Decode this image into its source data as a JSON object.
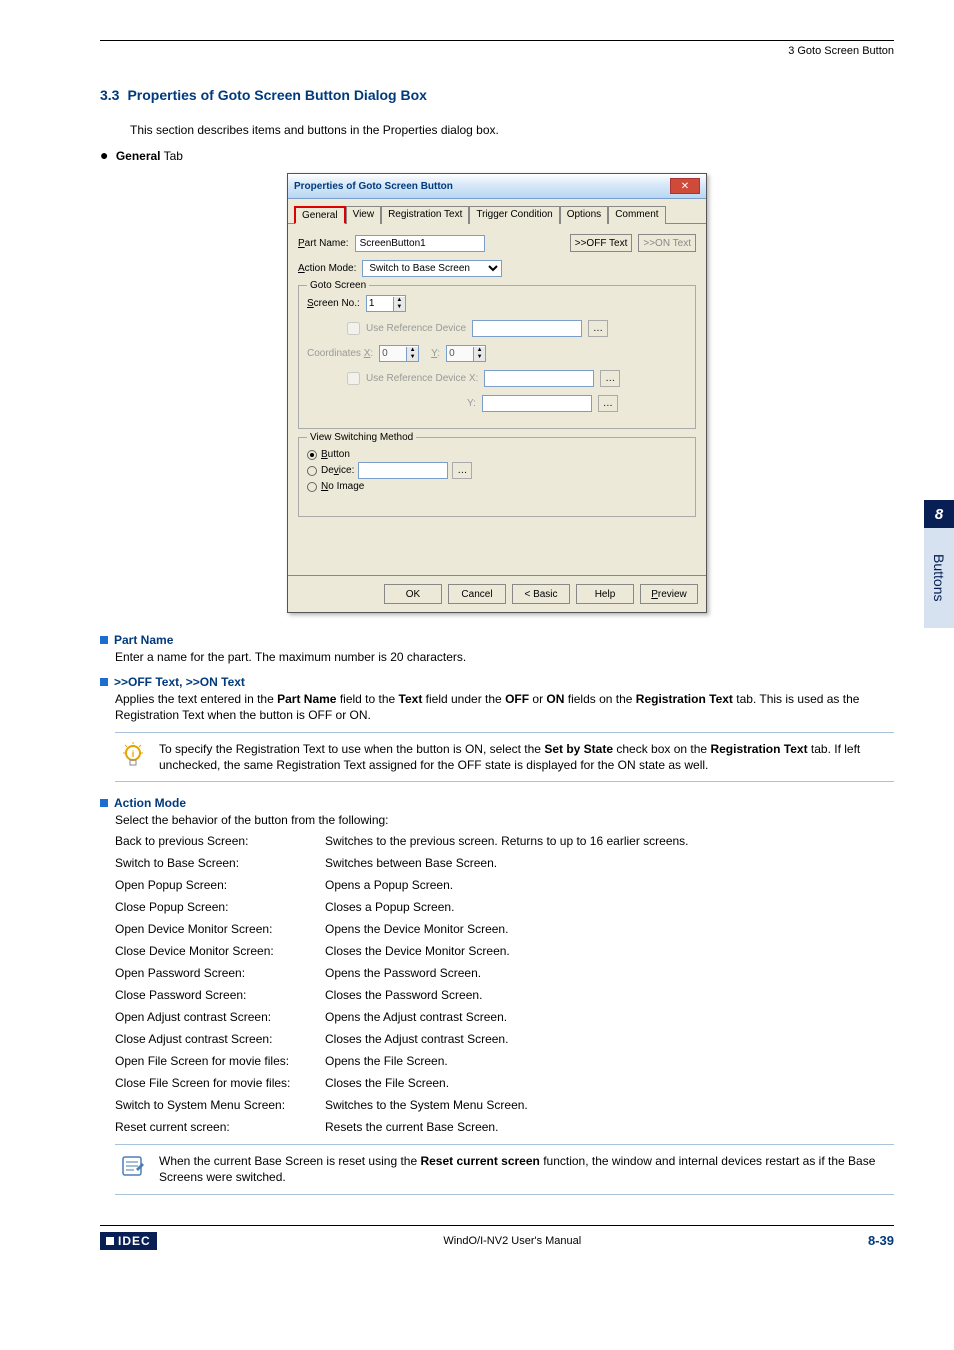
{
  "chapter_ref": "3 Goto Screen Button",
  "section": {
    "num": "3.3",
    "title": "Properties of Goto Screen Button Dialog Box"
  },
  "intro": "This section describes items and buttons in the Properties dialog box.",
  "general_tab_label": "General",
  "tab_suffix": " Tab",
  "dialog": {
    "title": "Properties of Goto Screen Button",
    "tabs": [
      "General",
      "View",
      "Registration Text",
      "Trigger Condition",
      "Options",
      "Comment"
    ],
    "part_name_label": "Part Name:",
    "part_name_value": "ScreenButton1",
    "btn_off_text": ">>OFF Text",
    "btn_on_text": ">>ON Text",
    "action_mode_label": "Action Mode:",
    "action_mode_value": "Switch to Base Screen",
    "group_goto": "Goto Screen",
    "screen_no_label": "Screen No.:",
    "screen_no_value": "1",
    "use_ref_device": "Use Reference Device",
    "coord_label": "Coordinates X:",
    "coord_x": "0",
    "coord_y_label": "Y:",
    "coord_y": "0",
    "use_ref_device_x": "Use Reference Device   X:",
    "coord_y2_label": "Y:",
    "group_view": "View Switching Method",
    "radio_button": "Button",
    "radio_device": "Device:",
    "radio_noimage": "No Image",
    "footer": {
      "ok": "OK",
      "cancel": "Cancel",
      "basic": "< Basic",
      "help": "Help",
      "preview": "Preview"
    }
  },
  "part_name": {
    "heading": "Part Name",
    "body": "Enter a name for the part. The maximum number is 20 characters."
  },
  "off_on": {
    "heading": ">>OFF Text, >>ON Text",
    "body_prefix": "Applies the text entered in the ",
    "bold1": "Part Name",
    "body_mid1": " field to the ",
    "bold2": "Text",
    "body_mid2": " field under the ",
    "bold3": "OFF",
    "body_mid3": " or ",
    "bold4": "ON",
    "body_mid4": " fields on the ",
    "bold5": "Registration Text",
    "body_suffix": " tab. This is used as the Registration Text when the button is OFF or ON."
  },
  "note1": {
    "p1a": "To specify the Registration Text to use when the button is ON, select the ",
    "b1": "Set by State",
    "p1b": " check box on the ",
    "b2": "Registration Text",
    "p1c": " tab. If left unchecked, the same Registration Text assigned for the OFF state is displayed for the ON state as well."
  },
  "action_mode": {
    "heading": "Action Mode",
    "body": "Select the behavior of the button from the following:",
    "rows": [
      {
        "label": "Back to previous Screen:",
        "desc": "Switches to the previous screen. Returns to up to 16 earlier screens."
      },
      {
        "label": "Switch to Base Screen:",
        "desc": "Switches between Base Screen."
      },
      {
        "label": "Open Popup Screen:",
        "desc": "Opens a Popup Screen."
      },
      {
        "label": "Close Popup Screen:",
        "desc": "Closes a Popup Screen."
      },
      {
        "label": "Open Device Monitor Screen:",
        "desc": "Opens the Device Monitor Screen."
      },
      {
        "label": "Close Device Monitor Screen:",
        "desc": "Closes the Device Monitor Screen."
      },
      {
        "label": "Open Password Screen:",
        "desc": "Opens the Password Screen."
      },
      {
        "label": "Close Password Screen:",
        "desc": "Closes the Password Screen."
      },
      {
        "label": "Open Adjust contrast Screen:",
        "desc": "Opens the Adjust contrast Screen."
      },
      {
        "label": "Close Adjust contrast Screen:",
        "desc": "Closes the Adjust contrast Screen."
      },
      {
        "label": "Open File Screen for movie files:",
        "desc": "Opens the File Screen."
      },
      {
        "label": "Close File Screen for movie files:",
        "desc": "Closes the File Screen."
      },
      {
        "label": "Switch to System Menu Screen:",
        "desc": "Switches to the System Menu Screen."
      },
      {
        "label": "Reset current screen:",
        "desc": "Resets the current Base Screen."
      }
    ]
  },
  "note2": {
    "p1a": "When the current Base Screen is reset using the ",
    "b1": "Reset current screen",
    "p1b": " function, the window and internal devices restart as if the Base Screens were switched."
  },
  "sidebar": {
    "num": "8",
    "label": "Buttons"
  },
  "footer": {
    "logo": "IDEC",
    "manual": "WindO/I-NV2 User's Manual",
    "page": "8-39"
  }
}
